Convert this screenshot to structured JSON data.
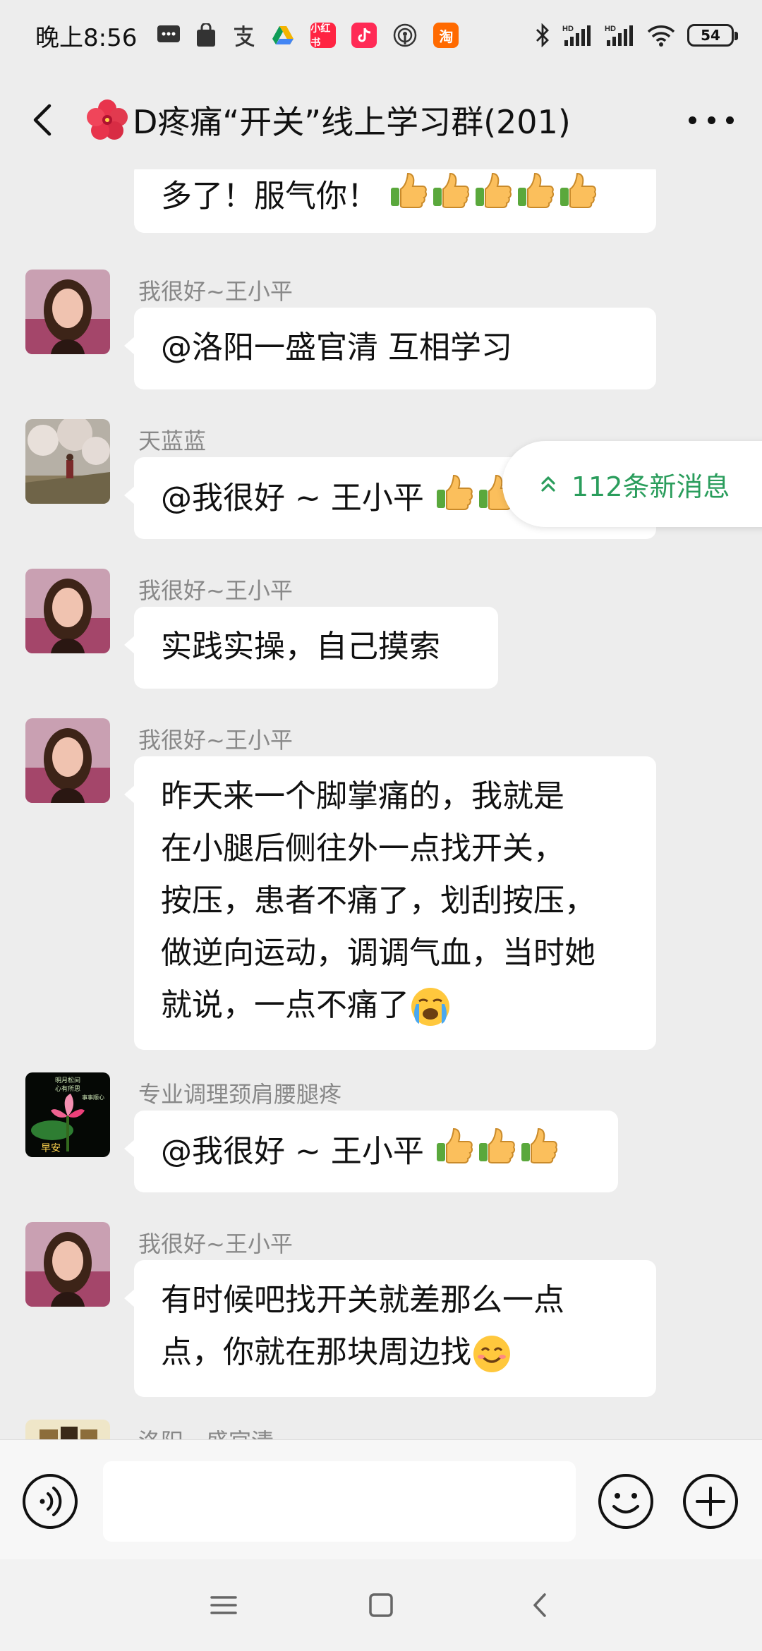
{
  "status_bar": {
    "time": "晚上8:56",
    "notification_icons": [
      "chat-dots-icon",
      "bag-icon",
      "alipay-icon",
      "drive-icon",
      "xiaohongshu-icon",
      "douyin-icon",
      "podcast-icon",
      "taobao-icon"
    ],
    "app_badges": {
      "xiaohongshu": "小红书",
      "taobao": "淘"
    },
    "signal_labels": [
      "HD",
      "HD"
    ],
    "battery": "54"
  },
  "header": {
    "title": "D疼痛“开关”线上学习群(201)"
  },
  "new_messages": {
    "label": "112条新消息"
  },
  "messages": [
    {
      "sender": "",
      "text": "多了！服气你！",
      "thumbs": 5
    },
    {
      "sender": "我很好~王小平",
      "text": "@洛阳一盛官清  互相学习"
    },
    {
      "sender": "天蓝蓝",
      "text": "@我很好 ~ 王小平",
      "thumbs": 4
    },
    {
      "sender": "我很好~王小平",
      "text": "实践实操，自己摸索"
    },
    {
      "sender": "我很好~王小平",
      "lines": [
        "昨天来一个脚掌痛的，我就是",
        "在小腿后侧往外一点找开关，",
        "按压，患者不痛了，划刮按压，",
        "做逆向运动，调调气血，当时她",
        "就说，一点不痛了"
      ]
    },
    {
      "sender": "专业调理颈肩腰腿疼",
      "text": "@我很好 ~ 王小平",
      "thumbs": 3
    },
    {
      "sender": "我很好~王小平",
      "lines": [
        "有时候吧找开关就差那么一点",
        "点，你就在那块周边找"
      ]
    },
    {
      "sender": "洛阳一盛官清"
    }
  ],
  "avatar_texts": {
    "lotus_line1": "明月松间",
    "lotus_line2": "心有所思",
    "lotus_line3": "事事顺心",
    "lotus_greeting": "早安"
  },
  "input": {
    "placeholder": ""
  },
  "colors": {
    "accent_green": "#2a9d5c",
    "bubble": "#ffffff",
    "background": "#ededed"
  }
}
